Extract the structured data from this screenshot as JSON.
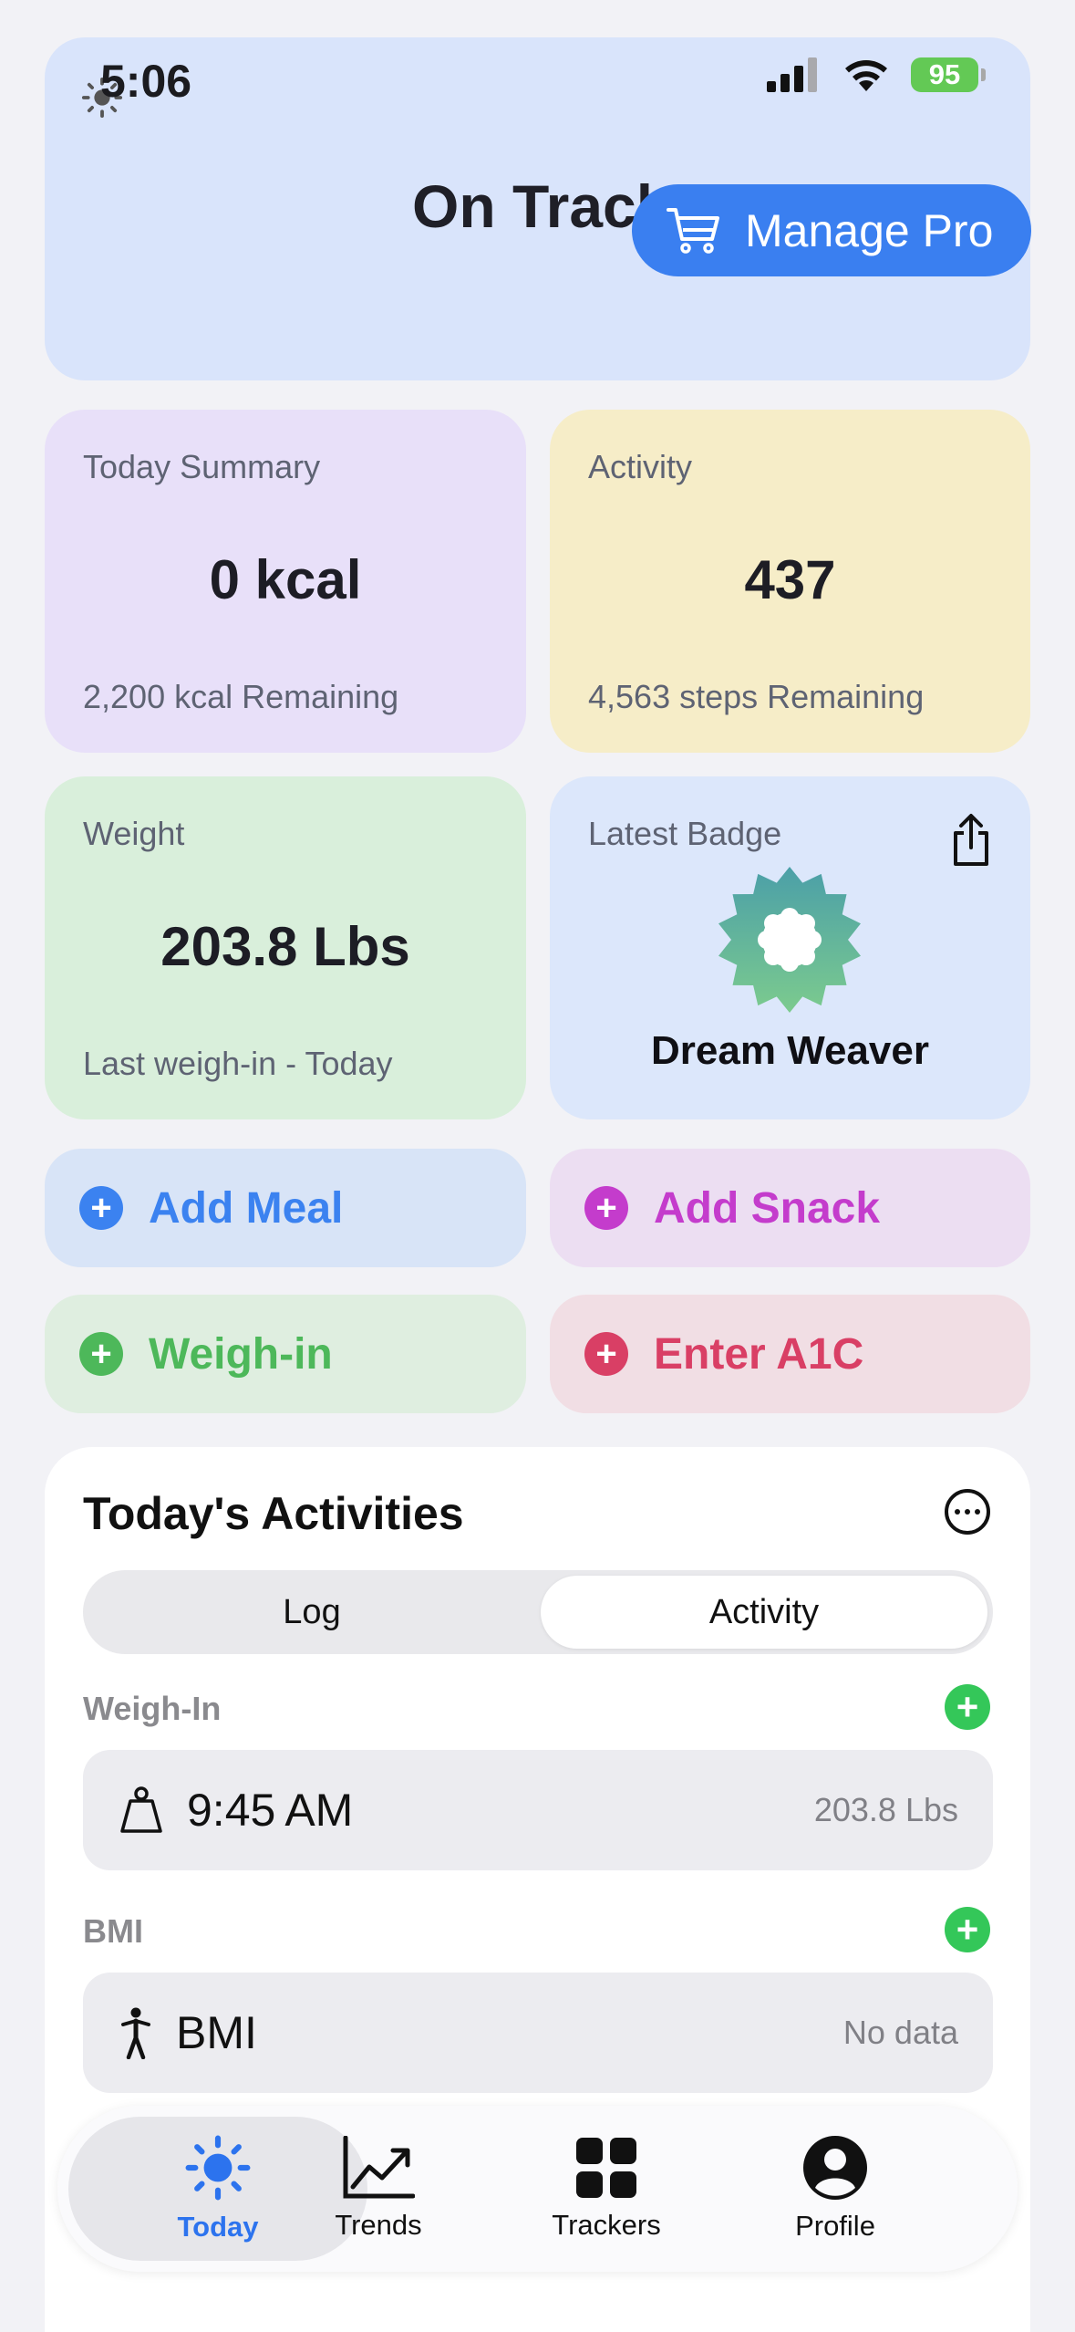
{
  "status_bar": {
    "time": "5:06",
    "battery": "95"
  },
  "header": {
    "title": "On Track",
    "manage_pro": "Manage Pro"
  },
  "summary": {
    "label": "Today Summary",
    "value": "0 kcal",
    "sub": "2,200 kcal Remaining"
  },
  "activity": {
    "label": "Activity",
    "value": "437",
    "sub": "4,563 steps Remaining"
  },
  "weight": {
    "label": "Weight",
    "value": "203.8 Lbs",
    "sub": "Last weigh-in - Today"
  },
  "badge": {
    "label": "Latest Badge",
    "name": "Dream Weaver"
  },
  "actions": {
    "add_meal": "Add Meal",
    "add_snack": "Add Snack",
    "weigh_in": "Weigh-in",
    "enter_a1c": "Enter A1C"
  },
  "activities": {
    "title": "Today's Activities",
    "tabs": [
      "Log",
      "Activity"
    ],
    "weigh_in_section": "Weigh-In",
    "weigh_in_time": "9:45 AM",
    "weigh_in_value": "203.8 Lbs",
    "bmi_section": "BMI",
    "bmi_label": "BMI",
    "bmi_value": "No data"
  },
  "tabbar": {
    "today": "Today",
    "trends": "Trends",
    "trackers": "Trackers",
    "profile": "Profile"
  },
  "colors": {
    "accent": "#3a7ff0",
    "green": "#34c759",
    "snack": "#c43ccc",
    "a1c": "#d93f65"
  }
}
